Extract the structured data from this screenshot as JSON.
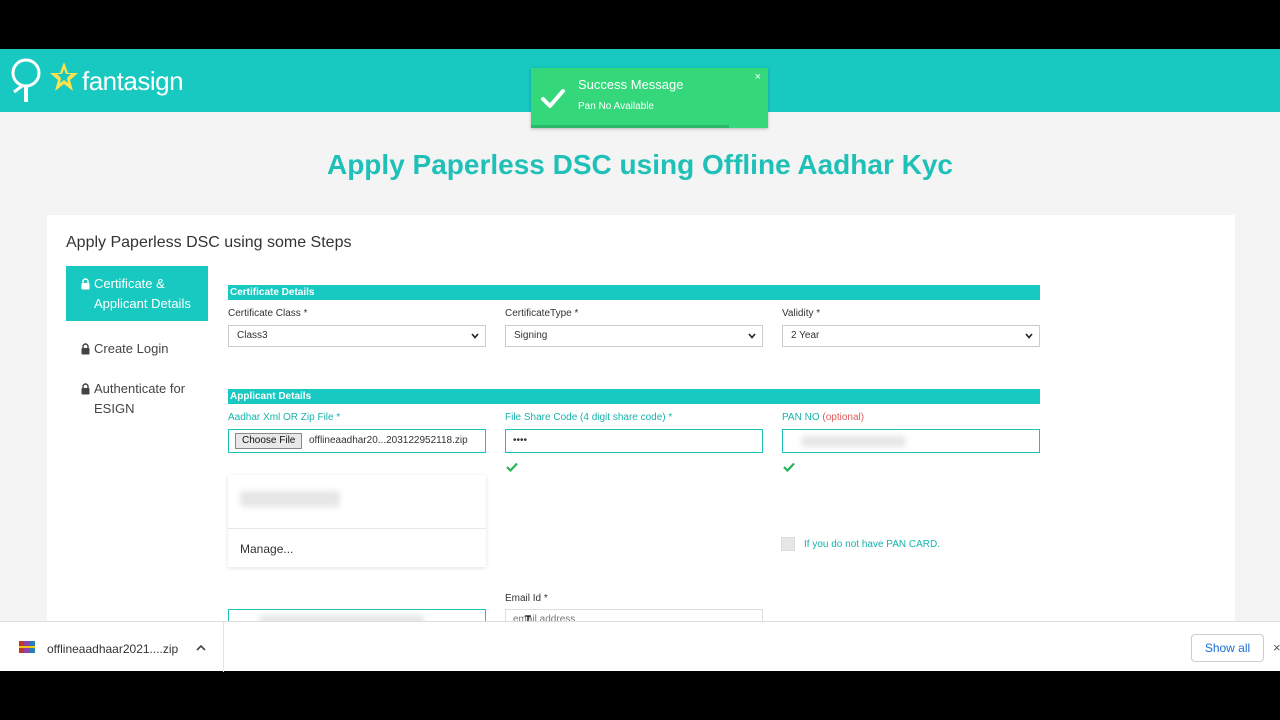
{
  "brand": {
    "logo_text": "fantasign"
  },
  "toast": {
    "title": "Success Message",
    "message": "Pan No Available",
    "close": "×"
  },
  "page": {
    "heading": "Apply Paperless DSC using Offline Aadhar Kyc"
  },
  "card": {
    "title": "Apply Paperless DSC using some Steps"
  },
  "steps": [
    {
      "label": "Certificate & Applicant Details",
      "active": true
    },
    {
      "label": "Create Login",
      "active": false
    },
    {
      "label": "Authenticate for ESIGN",
      "active": false
    }
  ],
  "certificate_section": {
    "title": "Certificate Details",
    "class_label": "Certificate Class *",
    "class_value": "Class3",
    "type_label": "CertificateType *",
    "type_value": "Signing",
    "validity_label": "Validity *",
    "validity_value": "2 Year"
  },
  "applicant_section": {
    "title": "Applicant Details",
    "file_label": "Aadhar Xml OR Zip File *",
    "file_button": "Choose File",
    "file_name": "offlineaadhar20...203122952118.zip",
    "share_code_label": "File Share Code (4 digit share code) *",
    "share_code_value": "••••",
    "pan_label": "PAN NO",
    "pan_optional": "(optional)",
    "no_pan_label": "If you do not have PAN CARD.",
    "autofill_manage": "Manage...",
    "email_label": "Email Id *",
    "email_placeholder": "email address"
  },
  "download_bar": {
    "file_name": "offlineaadhaar2021....zip",
    "show_all": "Show all",
    "close": "×"
  },
  "colors": {
    "primary": "#17c9c0",
    "toast": "#34d87a",
    "heading": "#1fc0b8"
  }
}
